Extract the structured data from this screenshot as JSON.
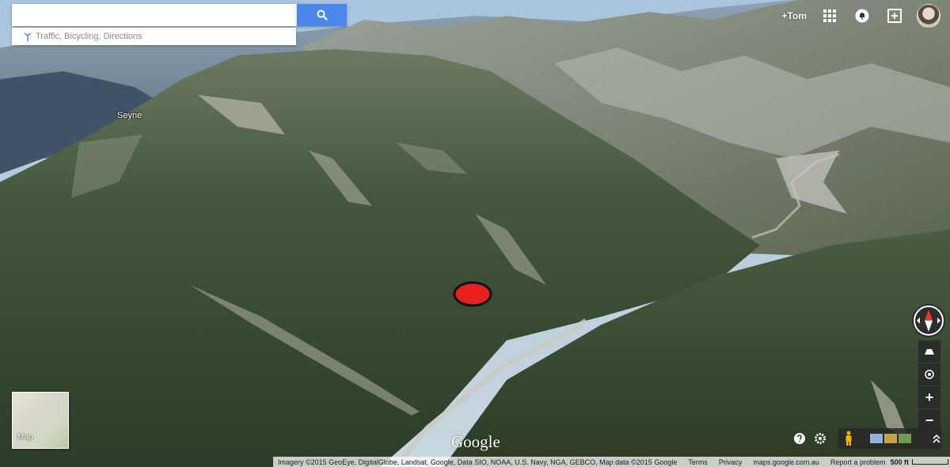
{
  "search": {
    "value": "",
    "placeholder": "",
    "button": "search-icon",
    "suggestion": "Traffic, Bicycling, Directions"
  },
  "account": {
    "plus_name": "+Tom"
  },
  "map": {
    "place_label": "Seyne",
    "minimap_label": "Map",
    "logo": "Google",
    "marker_color": "#e8211f"
  },
  "footer": {
    "imagery": "Imagery ©2015 GeoEye, DigitalGlobe, Landsat, Google, Data SIO, NOAA, U.S. Navy, NGA, GEBCO, Map data ©2015 Google",
    "terms": "Terms",
    "privacy": "Privacy",
    "domain": "maps.google.com.au",
    "report": "Report a problem",
    "scale": "500 ft"
  },
  "icons": {
    "apps": "apps-grid-icon",
    "notifications": "notifications-icon",
    "share": "share-icon",
    "compass": "compass-icon",
    "tilt": "tilt-icon",
    "location": "my-location-icon",
    "zoom_in": "+",
    "zoom_out": "−"
  }
}
